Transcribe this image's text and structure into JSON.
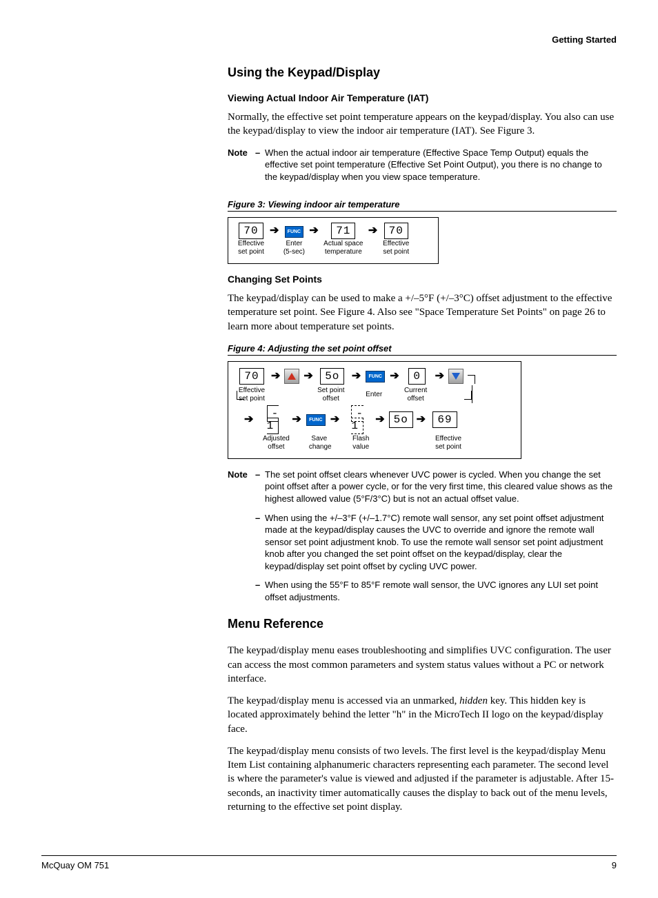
{
  "header": {
    "section": "Getting Started"
  },
  "h_keypad": "Using the Keypad/Display",
  "h_iat": "Viewing Actual Indoor Air Temperature (IAT)",
  "p_iat": "Normally, the effective set point temperature appears on the keypad/display. You also can use the keypad/display to view the indoor air temperature (IAT). See Figure 3.",
  "note1_label": "Note",
  "note1_text": "When the actual indoor air temperature (Effective Space Temp Output) equals the effective set point temperature (Effective Set Point Output), you there is no change to the keypad/display when you view space temperature.",
  "fig3_caption": "Figure 3: Viewing indoor air temperature",
  "fig3": {
    "d1": "70",
    "d2": "71",
    "d3": "70",
    "func": "FUNC",
    "l1a": "Effective",
    "l1b": "set point",
    "l2a": "Enter",
    "l2b": "(5-sec)",
    "l3a": "Actual space",
    "l3b": "temperature",
    "l4a": "Effective",
    "l4b": "set point"
  },
  "h_csp": "Changing Set Points",
  "p_csp": "The keypad/display can be used to make a +/–5°F (+/–3°C) offset adjustment to the effective temperature set point. See Figure 4. Also see \"Space Temperature Set Points\" on page 26 to learn more about temperature set points.",
  "fig4_caption": "Figure 4: Adjusting the set point offset",
  "fig4": {
    "d1": "70",
    "so1": "5o",
    "cur": "0",
    "adj": "- 1",
    "flash": "- 1",
    "so2": "5o",
    "eff": "69",
    "func": "FUNC",
    "l1a": "Effective",
    "l1b": "set point",
    "l2a": "Set point",
    "l2b": "offset",
    "l3a": "Enter",
    "l3b": "",
    "l4a": "Current",
    "l4b": "offset",
    "r2_l1a": "Adjusted",
    "r2_l1b": "offset",
    "r2_l2a": "Save",
    "r2_l2b": "change",
    "r2_l3a": "Flash",
    "r2_l3b": "value",
    "r2_l4a": "Effective",
    "r2_l4b": "set point"
  },
  "note2_label": "Note",
  "note2_1": "The set point offset clears whenever UVC power is cycled. When you change the set point offset after a power cycle, or for the very first time, this cleared value shows as the highest allowed value (5°F/3°C) but is not an actual offset value.",
  "note2_2": "When using the +/–3°F (+/–1.7°C) remote wall sensor, any set point offset adjustment made at the keypad/display causes the UVC to override and ignore the remote wall sensor set point adjustment knob. To use the remote wall sensor set point adjustment knob after you changed the set point offset on the keypad/display, clear the keypad/display set point offset by cycling UVC power.",
  "note2_3": "When using the 55°F to 85°F remote wall sensor, the UVC ignores any LUI set point offset adjustments.",
  "h_menu": "Menu Reference",
  "p_menu1": "The keypad/display menu eases troubleshooting and simplifies UVC configuration. The user can access the most common parameters and system status values without a PC or network interface.",
  "p_menu2a": "The keypad/display menu is accessed via an unmarked, ",
  "p_menu2_hidden": "hidden",
  "p_menu2b": " key. This hidden key is located approximately behind the letter \"h\" in the MicroTech II logo on the keypad/display face.",
  "p_menu3": "The keypad/display menu consists of two levels. The first level is the keypad/display Menu Item List containing alphanumeric characters representing each parameter. The second level is where the parameter's value is viewed and adjusted if the parameter is adjustable. After 15-seconds, an inactivity timer automatically causes the display to back out of the menu levels, returning to the effective set point display.",
  "footer": {
    "left": "McQuay OM 751",
    "right": "9"
  }
}
